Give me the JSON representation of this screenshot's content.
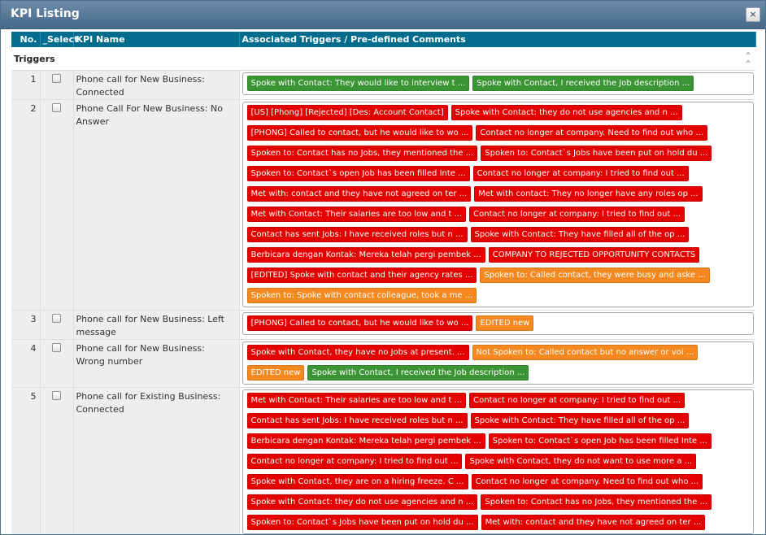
{
  "dialog": {
    "title": "KPI Listing",
    "close_label": "×"
  },
  "columns": {
    "no": "No.",
    "select": "_Select",
    "kpi_name": "KPI Name",
    "triggers": "Associated Triggers / Pre-defined Comments"
  },
  "group": {
    "label": "Triggers",
    "collapse_icon": "chevron-up-double-icon"
  },
  "colors": {
    "red": "#e50000",
    "green": "#3b9534",
    "orange": "#f5881f",
    "header": "#026c8f"
  },
  "rows": [
    {
      "no": "1",
      "name": "Phone call for New Business: Connected",
      "triggers": [
        {
          "text": "Spoke with Contact: They would like to interview t ...",
          "color": "green"
        },
        {
          "text": "Spoke with Contact, I received the Job description ...",
          "color": "green"
        }
      ]
    },
    {
      "no": "2",
      "name": "Phone Call For New Business: No Answer",
      "triggers": [
        {
          "text": "[US] [Phong] [Rejected] [Des: Account Contact]",
          "color": "red"
        },
        {
          "text": "Spoke with Contact: they do not use agencies and n ...",
          "color": "red"
        },
        {
          "text": "[PHONG] Called to contact, but he would like to wo ...",
          "color": "red"
        },
        {
          "text": "Contact no longer at company. Need to find out who ...",
          "color": "red"
        },
        {
          "text": "Spoken to: Contact has no Jobs, they mentioned the ...",
          "color": "red"
        },
        {
          "text": "Spoken to: Contact`s Jobs have been put on hold du ...",
          "color": "red"
        },
        {
          "text": "Spoken to: Contact`s open Job has been filled Inte ...",
          "color": "red"
        },
        {
          "text": "Contact no longer at company: I tried to find out ...",
          "color": "red"
        },
        {
          "text": "Met with: contact and they have not agreed on ter ...",
          "color": "red"
        },
        {
          "text": "Met with contact: They no longer have any roles op ...",
          "color": "red"
        },
        {
          "text": "Met with Contact: Their salaries are too low and t ...",
          "color": "red"
        },
        {
          "text": "Contact no longer at company: I tried to find out ...",
          "color": "red"
        },
        {
          "text": "Contact has sent Jobs: I have received roles but n ...",
          "color": "red"
        },
        {
          "text": "Spoke with Contact: They have filled all of the op ...",
          "color": "red"
        },
        {
          "text": "Berbicara dengan Kontak: Mereka telah pergi pembek ...",
          "color": "red"
        },
        {
          "text": "COMPANY TO REJECTED OPPORTUNITY CONTACTS",
          "color": "red"
        },
        {
          "text": "[EDITED] Spoke with contact and their agency rates ...",
          "color": "red"
        },
        {
          "text": "Spoken to: Called contact, they were busy and aske ...",
          "color": "orange"
        },
        {
          "text": "Spoken to: Spoke with contact colleague, took a me ...",
          "color": "orange"
        }
      ]
    },
    {
      "no": "3",
      "name": "Phone call for New Business: Left message",
      "triggers": [
        {
          "text": "[PHONG] Called to contact, but he would like to wo ...",
          "color": "red"
        },
        {
          "text": "EDITED new",
          "color": "orange"
        }
      ]
    },
    {
      "no": "4",
      "name": "Phone call for New Business: Wrong number",
      "triggers": [
        {
          "text": "Spoke with Contact, they have no Jobs at present. ...",
          "color": "red"
        },
        {
          "text": "Not Spoken to: Called contact but no answer or voi ...",
          "color": "orange"
        },
        {
          "text": "EDITED new",
          "color": "orange"
        },
        {
          "text": "Spoke with Contact, I received the Job description ...",
          "color": "green"
        }
      ]
    },
    {
      "no": "5",
      "name": "Phone call for Existing Business: Connected",
      "triggers": [
        {
          "text": "Met with Contact: Their salaries are too low and t ...",
          "color": "red"
        },
        {
          "text": "Contact no longer at company: I tried to find out ...",
          "color": "red"
        },
        {
          "text": "Contact has sent Jobs: I have received roles but n ...",
          "color": "red"
        },
        {
          "text": "Spoke with Contact: They have filled all of the op ...",
          "color": "red"
        },
        {
          "text": "Berbicara dengan Kontak: Mereka telah pergi pembek ...",
          "color": "red"
        },
        {
          "text": "Spoken to: Contact`s open Job has been filled Inte ...",
          "color": "red"
        },
        {
          "text": "Contact no longer at company: I tried to find out ...",
          "color": "red"
        },
        {
          "text": "Spoke with Contact, they do not want to use more a ...",
          "color": "red"
        },
        {
          "text": "Spoke with Contact, they are on a hiring freeze. C ...",
          "color": "red"
        },
        {
          "text": "Contact no longer at company. Need to find out who ...",
          "color": "red"
        },
        {
          "text": "Spoke with Contact: they do not use agencies and n ...",
          "color": "red"
        },
        {
          "text": "Spoken to: Contact has no Jobs, they mentioned the ...",
          "color": "red"
        },
        {
          "text": "Spoken to: Contact`s Jobs have been put on hold du ...",
          "color": "red"
        },
        {
          "text": "Met with: contact and they have not agreed on ter ...",
          "color": "red"
        }
      ]
    }
  ]
}
